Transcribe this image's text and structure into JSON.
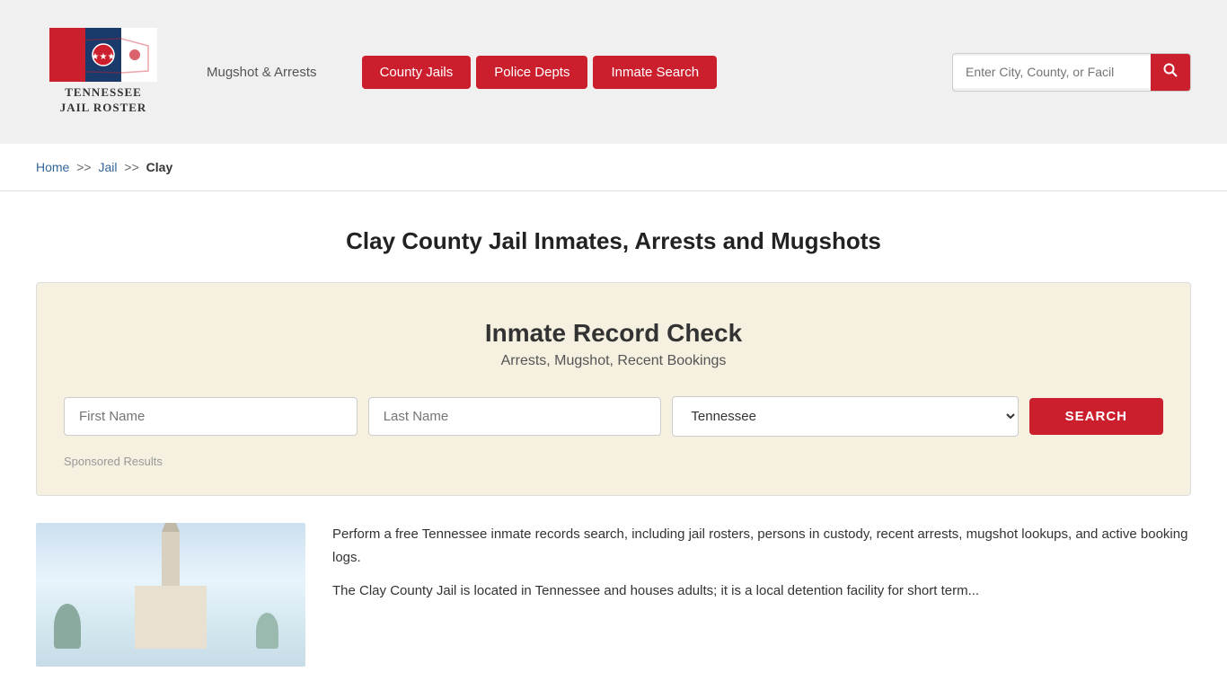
{
  "header": {
    "logo_line1": "TENNESSEE",
    "logo_line2": "JAIL ROSTER",
    "mugshot_link": "Mugshot & Arrests",
    "nav": {
      "county_jails": "County Jails",
      "police_depts": "Police Depts",
      "inmate_search": "Inmate Search"
    },
    "search_placeholder": "Enter City, County, or Facil"
  },
  "breadcrumb": {
    "home": "Home",
    "sep1": ">>",
    "jail": "Jail",
    "sep2": ">>",
    "current": "Clay"
  },
  "page": {
    "title": "Clay County Jail Inmates, Arrests and Mugshots"
  },
  "record_check": {
    "title": "Inmate Record Check",
    "subtitle": "Arrests, Mugshot, Recent Bookings",
    "first_name_placeholder": "First Name",
    "last_name_placeholder": "Last Name",
    "state_default": "Tennessee",
    "search_button": "SEARCH",
    "sponsored_label": "Sponsored Results"
  },
  "bottom_text": {
    "paragraph1": "Perform a free Tennessee inmate records search, including jail rosters, persons in custody, recent arrests, mugshot lookups, and active booking logs.",
    "paragraph2": "The Clay County Jail is located in Tennessee and houses adults; it is a local detention facility for short term..."
  }
}
